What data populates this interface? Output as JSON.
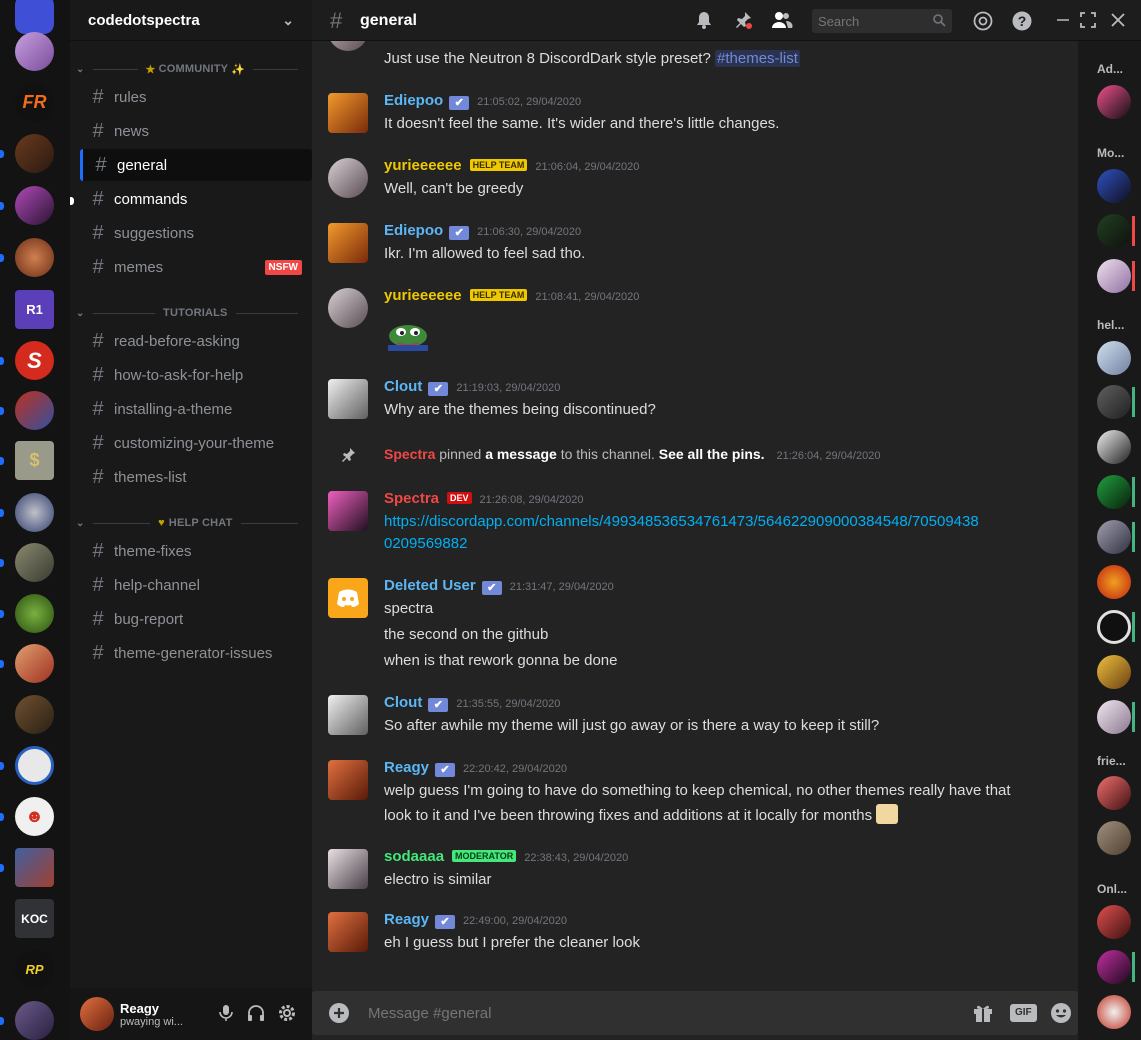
{
  "server": {
    "name": "codedotspectra"
  },
  "categories": [
    {
      "label": "COMMUNITY",
      "icon_left": "★",
      "icon_right": "✨"
    },
    {
      "label": "TUTORIALS"
    },
    {
      "label": "HELP CHAT",
      "icon_left": "♥"
    }
  ],
  "channels": [
    {
      "name": "rules"
    },
    {
      "name": "news"
    },
    {
      "name": "general",
      "selected": true
    },
    {
      "name": "commands",
      "unread": true
    },
    {
      "name": "suggestions"
    },
    {
      "name": "memes",
      "badge": "NSFW"
    },
    {
      "name": "read-before-asking"
    },
    {
      "name": "how-to-ask-for-help"
    },
    {
      "name": "installing-a-theme"
    },
    {
      "name": "customizing-your-theme"
    },
    {
      "name": "themes-list"
    },
    {
      "name": "theme-fixes"
    },
    {
      "name": "help-channel"
    },
    {
      "name": "bug-report"
    },
    {
      "name": "theme-generator-issues"
    }
  ],
  "user": {
    "name": "Reagy",
    "status": "pwaying wi..."
  },
  "header": {
    "channel": "general",
    "search_placeholder": "Search"
  },
  "messages": [
    {
      "text": "Just use the Neutron 8 DiscordDark style preset?",
      "mention": "#themes-list"
    },
    {
      "author": "Ediepoo",
      "author_color": "#5cb6f5",
      "time": "21:05:02, 29/04/2020",
      "lines": [
        "It doesn't feel the same. It's wider and there's little changes."
      ]
    },
    {
      "author": "yurieeeeee",
      "author_color": "#f0c800",
      "role": "HELP TEAM",
      "time": "21:06:04, 29/04/2020",
      "lines": [
        "Well, can't be greedy"
      ]
    },
    {
      "author": "Ediepoo",
      "author_color": "#5cb6f5",
      "time": "21:06:30, 29/04/2020",
      "lines": [
        "Ikr. I'm allowed to feel sad tho."
      ]
    },
    {
      "author": "yurieeeeee",
      "author_color": "#f0c800",
      "role": "HELP TEAM",
      "time": "21:08:41, 29/04/2020",
      "lines": []
    },
    {
      "author": "Clout",
      "author_color": "#5cb6f5",
      "time": "21:19:03, 29/04/2020",
      "lines": [
        "Why are the themes being discontinued?"
      ]
    },
    {
      "author": "Spectra",
      "author_color": "#f04747",
      "role": "DEV",
      "time": "21:26:08, 29/04/2020",
      "lines": [
        "https://discordapp.com/channels/499348536534761473/564622909000384548/70509438",
        "0209569882"
      ]
    },
    {
      "author": "Deleted User",
      "author_color": "#5cb6f5",
      "time": "21:31:47, 29/04/2020",
      "lines": [
        "spectra",
        "the second on the github",
        "when is that rework gonna be done"
      ]
    },
    {
      "author": "Clout",
      "author_color": "#5cb6f5",
      "time": "21:35:55, 29/04/2020",
      "lines": [
        "So after awhile my theme will just go away or is there a way to keep it still?"
      ]
    },
    {
      "author": "Reagy",
      "author_color": "#5cb6f5",
      "time": "22:20:42, 29/04/2020",
      "lines": [
        "welp guess I'm going to have do something to keep chemical, no other themes really have that",
        "look to it and I've been throwing fixes and additions at it locally for months"
      ]
    },
    {
      "author": "sodaaaa",
      "author_color": "#43e87a",
      "role": "MODERATOR",
      "time": "22:38:43, 29/04/2020",
      "lines": [
        "electro is similar"
      ]
    },
    {
      "author": "Reagy",
      "author_color": "#5cb6f5",
      "time": "22:49:00, 29/04/2020",
      "lines": [
        "eh I guess but I prefer the cleaner look"
      ]
    }
  ],
  "system_message": {
    "actor": "Spectra",
    "action": "pinned",
    "link1": "a message",
    "mid": "to this channel.",
    "link2": "See all the pins.",
    "time": "21:26:04, 29/04/2020"
  },
  "composer": {
    "placeholder": "Message #general",
    "gif_label": "GIF"
  },
  "member_groups": [
    "Ad...",
    "Mo...",
    "hel...",
    "frie...",
    "Onl..."
  ],
  "server_icons": [
    "KOC",
    "RP"
  ]
}
